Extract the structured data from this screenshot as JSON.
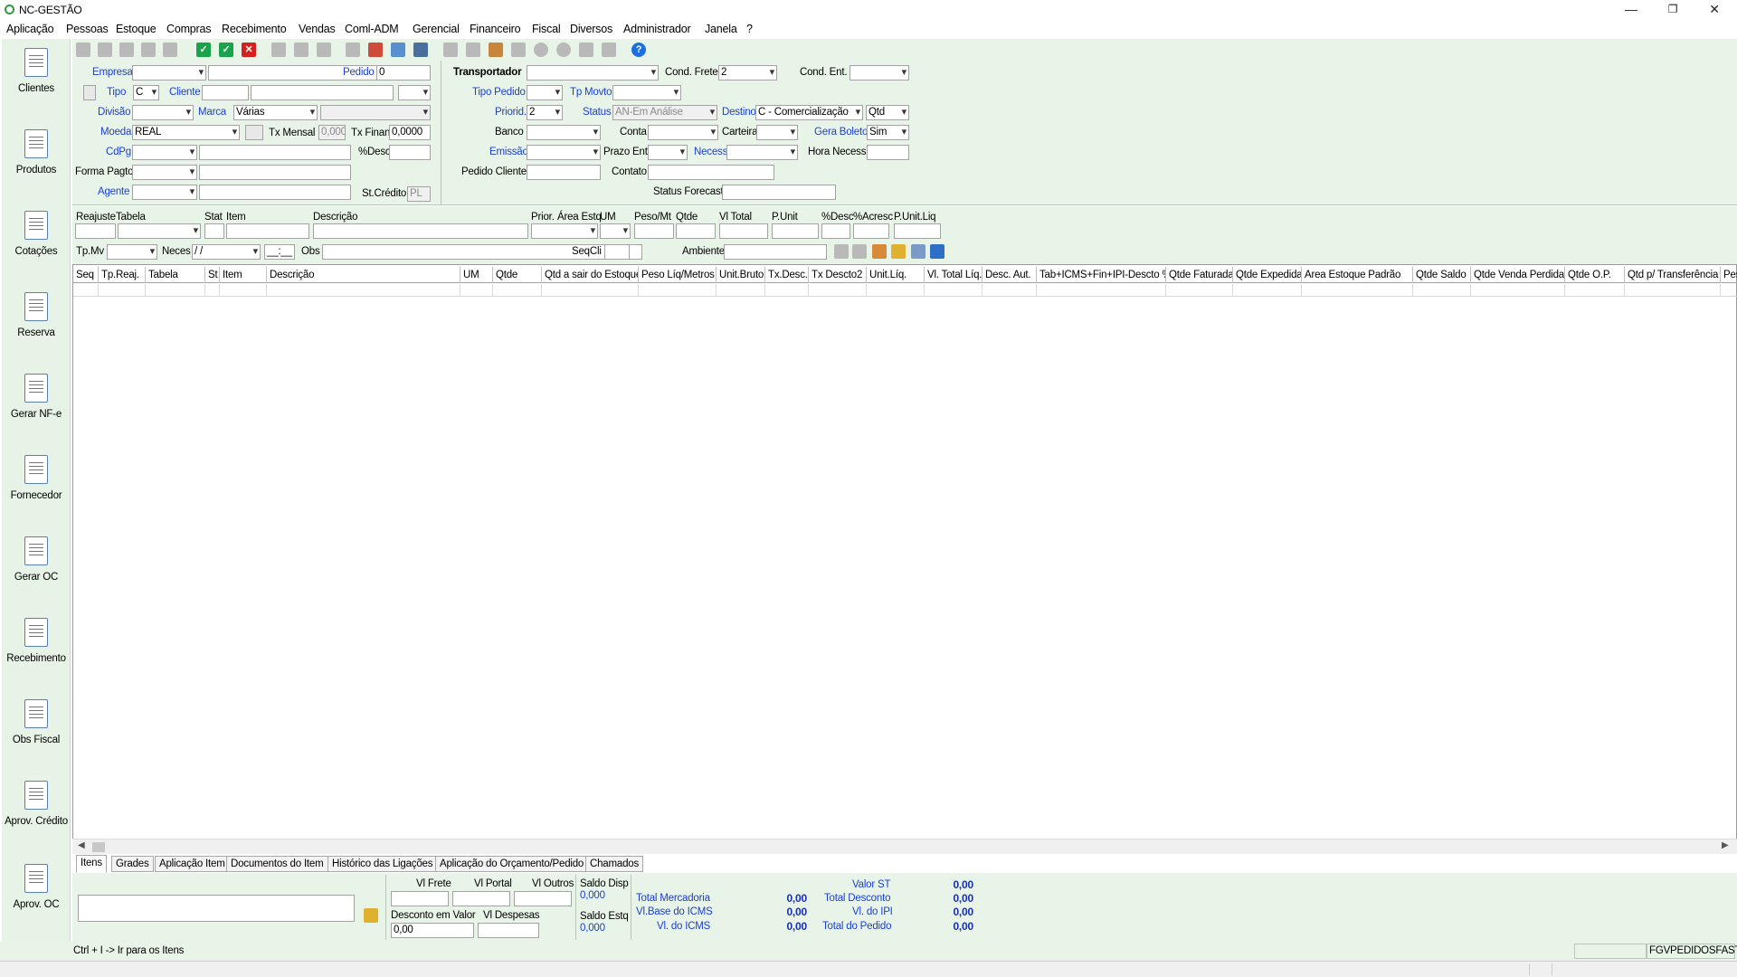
{
  "window": {
    "title": "NC-GESTÃO",
    "minimize": "—",
    "restore": "❐",
    "close": "✕"
  },
  "menu": [
    "Aplicação",
    "Pessoas",
    "Estoque",
    "Compras",
    "Recebimento",
    "Vendas",
    "Coml-ADM",
    "Gerencial",
    "Financeiro",
    "Fiscal",
    "Diversos",
    "Administrador",
    "Janela",
    "?"
  ],
  "sidebar": [
    "Clientes",
    "Produtos",
    "Cotações",
    "Reserva",
    "Gerar NF-e",
    "Fornecedor",
    "Gerar OC",
    "Recebimento",
    "Obs Fiscal",
    "Aprov. Crédito",
    "Aprov. OC"
  ],
  "header": {
    "empresa": "Empresa",
    "pedido": "Pedido",
    "pedido_value": "0",
    "tipo": "Tipo",
    "tipo_value": "C",
    "cliente": "Cliente",
    "divisao": "Divisão",
    "marca": "Marca",
    "marca_value": "Várias",
    "moeda": "Moeda",
    "moeda_value": "REAL",
    "tx_mensal": "Tx Mensal",
    "tx_mensal_value": "0,000(",
    "tx_finan": "Tx Finan",
    "tx_finan_value": "0,0000",
    "cdpg": "CdPg",
    "desc": "%Desc",
    "forma_pagto": "Forma Pagto",
    "agente": "Agente",
    "st_credito": "St.Crédito",
    "st_credito_value": "PL",
    "transportador": "Transportador",
    "cond_frete": "Cond. Frete",
    "cond_frete_value": "2",
    "cond_ent": "Cond. Ent.",
    "tipo_pedido": "Tipo Pedido",
    "tp_movto": "Tp Movto",
    "priorid": "Priorid.",
    "priorid_value": "2",
    "status": "Status",
    "status_value": "AN-Em Análise",
    "destino": "Destino",
    "destino_value": "C - Comercialização",
    "qtd_value": "Qtd",
    "banco": "Banco",
    "conta": "Conta",
    "carteira": "Carteira",
    "gera_boleto": "Gera Boleto",
    "gera_boleto_value": "Sim",
    "emissao": "Emissão",
    "prazo_ent": "Prazo Ent",
    "necess": "Necess",
    "hora_necess": "Hora Necess",
    "pedido_cliente": "Pedido Cliente",
    "contato": "Contato",
    "status_forecast": "Status Forecast"
  },
  "item_form": {
    "reajuste": "Reajuste",
    "tabela": "Tabela",
    "stat": "Stat",
    "item": "Item",
    "descricao": "Descrição",
    "prior": "Prior.",
    "area_estq": "Área Estq",
    "um": "UM",
    "peso_mt": "Peso/Mt",
    "qtde": "Qtde",
    "vl_total": "Vl Total",
    "p_unit": "P.Unit",
    "pdesc": "%Desc",
    "pacresc": "%Acresc",
    "p_unit_liq": "P.Unit.Liq",
    "tp_mv": "Tp.Mv",
    "neces": "Neces",
    "neces_value": " / /",
    "hora_value": "__:__",
    "obs": "Obs",
    "seqcli": "SeqCli",
    "ambiente": "Ambiente"
  },
  "grid_columns": [
    "Seq",
    "Tp.Reaj.",
    "Tabela",
    "St",
    "Item",
    "Descrição",
    "UM",
    "Qtde",
    "Qtd a sair do Estoque",
    "Peso Líq/Metros",
    "Unit.Bruto",
    "Tx.Desc.",
    "Tx Descto2",
    "Unit.Líq.",
    "Vl. Total Líq.",
    "Desc. Aut.",
    "Tab+ICMS+Fin+IPI-Descto %",
    "Qtde Faturada",
    "Qtde Expedida",
    "Area Estoque Padrão",
    "Qtde Saldo",
    "Qtde Venda Perdida",
    "Qtde O.P.",
    "Qtd p/ Transferência",
    "Pes"
  ],
  "tabs": [
    "Itens",
    "Grades",
    "Aplicação Item",
    "Documentos do Item",
    "Histórico das Ligações",
    "Aplicação do Orçamento/Pedido",
    "Chamados"
  ],
  "totals": {
    "vl_frete": "Vl Frete",
    "vl_portal": "Vl Portal",
    "vl_outros": "Vl Outros",
    "desconto_valor": "Desconto em Valor",
    "desconto_valor_value": "0,00",
    "vl_despesas": "Vl Despesas",
    "saldo_disp": "Saldo Disp",
    "saldo_disp_value": "0,000",
    "saldo_estq": "Saldo Estq",
    "saldo_estq_value": "0,000",
    "total_mercadoria": "Total Mercadoria",
    "total_mercadoria_value": "0,00",
    "vl_base_icms": "Vl.Base do ICMS",
    "vl_base_icms_value": "0,00",
    "vl_icms": "Vl. do ICMS",
    "vl_icms_value": "0,00",
    "valor_st": "Valor ST",
    "valor_st_value": "0,00",
    "total_desconto": "Total Desconto",
    "total_desconto_value": "0,00",
    "vl_ipi": "Vl. do IPI",
    "vl_ipi_value": "0,00",
    "total_pedido": "Total do Pedido",
    "total_pedido_value": "0,00"
  },
  "status": {
    "hint": "Ctrl + I -> Ir para os Itens",
    "form_name": "FGVPEDIDOSFAST"
  }
}
